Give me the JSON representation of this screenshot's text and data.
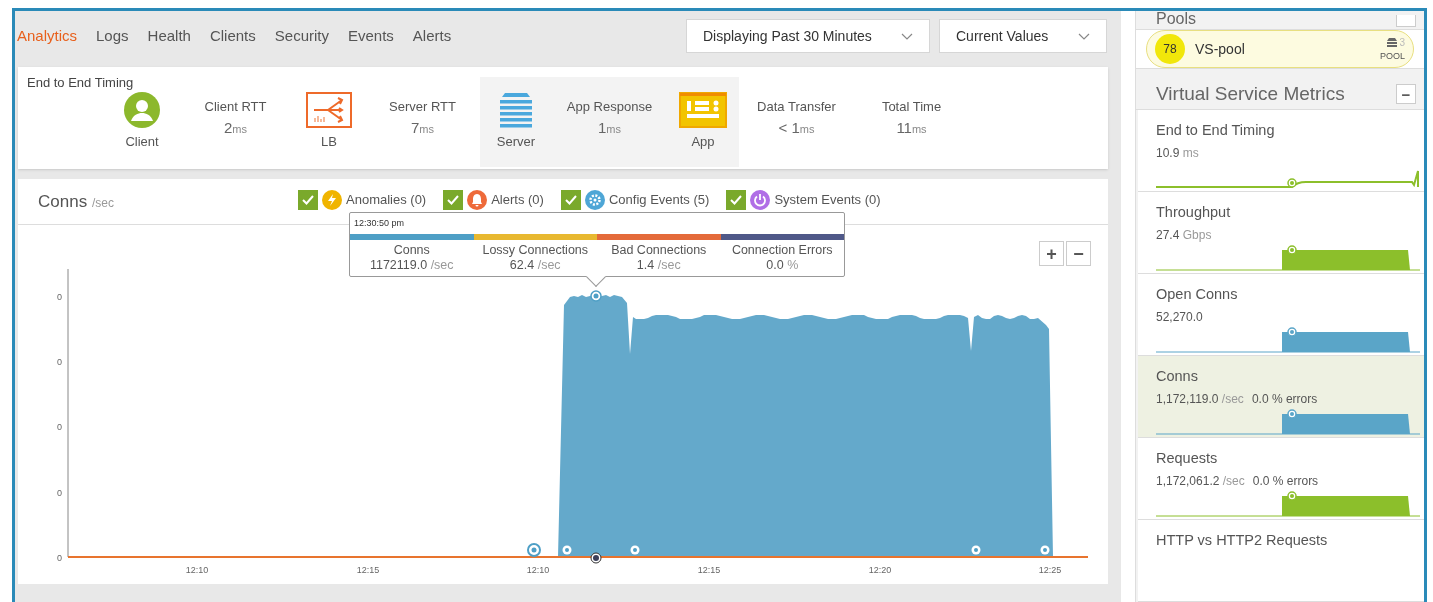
{
  "tabs": [
    {
      "label": "Analytics",
      "selected": true
    },
    {
      "label": "Logs",
      "selected": false
    },
    {
      "label": "Health",
      "selected": false
    },
    {
      "label": "Clients",
      "selected": false
    },
    {
      "label": "Security",
      "selected": false
    },
    {
      "label": "Events",
      "selected": false
    },
    {
      "label": "Alerts",
      "selected": false
    }
  ],
  "dropdowns": [
    {
      "value": "Displaying Past 30 Minutes"
    },
    {
      "value": "Current Values"
    }
  ],
  "timing": {
    "title": "End to End Timing",
    "items": [
      {
        "kind": "client",
        "label": "Client",
        "shaded": false
      },
      {
        "kind": "metric",
        "label": "Client RTT",
        "value": "2",
        "unit": "ms",
        "shaded": false
      },
      {
        "kind": "lb",
        "label": "LB",
        "shaded": false
      },
      {
        "kind": "metric",
        "label": "Server RTT",
        "value": "7",
        "unit": "ms",
        "shaded": false
      },
      {
        "kind": "server",
        "label": "Server",
        "shaded": true
      },
      {
        "kind": "metric",
        "label": "App Response",
        "value": "1",
        "unit": "ms",
        "shaded": true
      },
      {
        "kind": "app",
        "label": "App",
        "shaded": true
      },
      {
        "kind": "metric",
        "label": "Data Transfer",
        "value": "< 1",
        "unit": "ms",
        "shaded": false
      },
      {
        "kind": "metric",
        "label": "Total Time",
        "value": "11",
        "unit": "ms",
        "shaded": false
      }
    ]
  },
  "chart": {
    "title": "Conns",
    "unit": "/sec",
    "toggles": [
      {
        "label": "Anomalies (0)",
        "checked": true,
        "kind": "anomaly",
        "color": "#f0b400"
      },
      {
        "label": "Alerts (0)",
        "checked": true,
        "kind": "alert",
        "color": "#ee6a3a"
      },
      {
        "label": "Config Events (5)",
        "checked": true,
        "kind": "config",
        "color": "#4ea6d6"
      },
      {
        "label": "System Events (0)",
        "checked": true,
        "kind": "system",
        "color": "#b06ee6"
      }
    ],
    "zoom_in": "+",
    "zoom_out": "−",
    "tooltip": {
      "time": "12:30:50 pm",
      "columns": [
        {
          "name": "Conns",
          "value": "1172119.0",
          "unit": "/sec",
          "color": "#4e9fc6"
        },
        {
          "name": "Lossy Connections",
          "value": "62.4",
          "unit": "/sec",
          "color": "#e8b830"
        },
        {
          "name": "Bad Connections",
          "value": "1.4",
          "unit": "/sec",
          "color": "#e46a3a"
        },
        {
          "name": "Connection Errors",
          "value": "0.0",
          "unit": "%",
          "color": "#4f5888"
        }
      ]
    },
    "y_tick_labels": [
      "0",
      "0",
      "0",
      "0",
      "0"
    ],
    "x_tick_labels": [
      "12:10",
      "12:15",
      "12:10",
      "12:15",
      "12:20",
      "12:25"
    ]
  },
  "sidebar": {
    "pools_title": "Pools",
    "pool": {
      "score": "78",
      "name": "VS-pool",
      "count": "3",
      "type": "POOL"
    },
    "metrics_title": "Virtual Service Metrics",
    "collapse": "−",
    "metrics": [
      {
        "title": "End to End Timing",
        "value": "10.9",
        "unit": "ms",
        "kind": "line",
        "color": "#8cbf2b",
        "selected": false
      },
      {
        "title": "Throughput",
        "value": "27.4",
        "unit": "Gbps",
        "kind": "area",
        "color": "#8cbf2b",
        "selected": false
      },
      {
        "title": "Open Conns",
        "value": "52,270.0",
        "kind": "area",
        "color": "#5aa5c8",
        "selected": false
      },
      {
        "title": "Conns",
        "value": "1,172,119.0",
        "unit": "/sec",
        "errors": "0.0 % errors",
        "kind": "area",
        "color": "#5aa5c8",
        "selected": true
      },
      {
        "title": "Requests",
        "value": "1,172,061.2",
        "unit": "/sec",
        "errors": "0.0 % errors",
        "kind": "area",
        "color": "#8cbf2b",
        "selected": false
      },
      {
        "title": "HTTP vs HTTP2 Requests",
        "kind": "none",
        "selected": false
      }
    ]
  }
}
